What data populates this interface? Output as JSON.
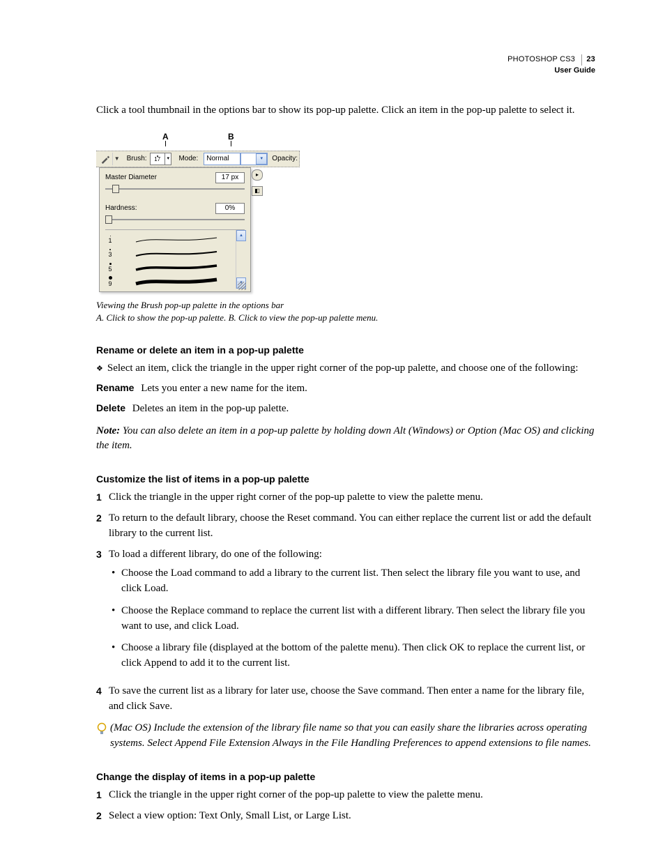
{
  "header": {
    "product": "PHOTOSHOP CS3",
    "guide": "User Guide",
    "page": "23"
  },
  "intro": "Click a tool thumbnail in the options bar to show its pop-up palette. Click an item in the pop-up palette to select it.",
  "figure": {
    "calloutA": "A",
    "calloutB": "B",
    "toolbar": {
      "brushLabel": "Brush:",
      "brushSize": "17",
      "modeLabel": "Mode:",
      "modeValue": "Normal",
      "opacityLabel": "Opacity:"
    },
    "popup": {
      "masterDiameter": "Master Diameter",
      "masterValue": "17 px",
      "hardness": "Hardness:",
      "hardnessValue": "0%",
      "sizes": [
        "1",
        "3",
        "5",
        "9"
      ]
    },
    "captionLine1": "Viewing the Brush pop-up palette in the options bar",
    "captionA": "A.",
    "captionAText": " Click to show the pop-up palette.  ",
    "captionB": "B.",
    "captionBText": " Click to view the pop-up palette menu."
  },
  "section1": {
    "heading": "Rename or delete an item in a pop-up palette",
    "lead": "Select an item, click the triangle in the upper right corner of the pop-up palette, and choose one of the following:",
    "renameTerm": "Rename",
    "renameDef": "Lets you enter a new name for the item.",
    "deleteTerm": "Delete",
    "deleteDef": "Deletes an item in the pop-up palette.",
    "noteLabel": "Note:",
    "noteText": " You can also delete an item in a pop-up palette by holding down Alt (Windows) or Option (Mac OS) and clicking the item."
  },
  "section2": {
    "heading": "Customize the list of items in a pop-up palette",
    "step1": "Click the triangle in the upper right corner of the pop-up palette to view the palette menu.",
    "step2": "To return to the default library, choose the Reset command. You can either replace the current list or add the default library to the current list.",
    "step3": "To load a different library, do one of the following:",
    "step3a": "Choose the Load command to add a library to the current list. Then select the library file you want to use, and click Load.",
    "step3b": "Choose the Replace command to replace the current list with a different library. Then select the library file you want to use, and click Load.",
    "step3c": "Choose a library file (displayed at the bottom of the palette menu). Then click OK to replace the current list, or click Append to add it to the current list.",
    "step4": "To save the current list as a library for later use, choose the Save command. Then enter a name for the library file, and click Save.",
    "tip": "(Mac OS) Include the extension of the library file name so that you can easily share the libraries across operating systems. Select Append File Extension Always in the File Handling Preferences to append extensions to file names."
  },
  "section3": {
    "heading": "Change the display of items in a pop-up palette",
    "step1": "Click the triangle in the upper right corner of the pop-up palette to view the palette menu.",
    "step2": "Select a view option: Text Only, Small List, or Large List."
  }
}
